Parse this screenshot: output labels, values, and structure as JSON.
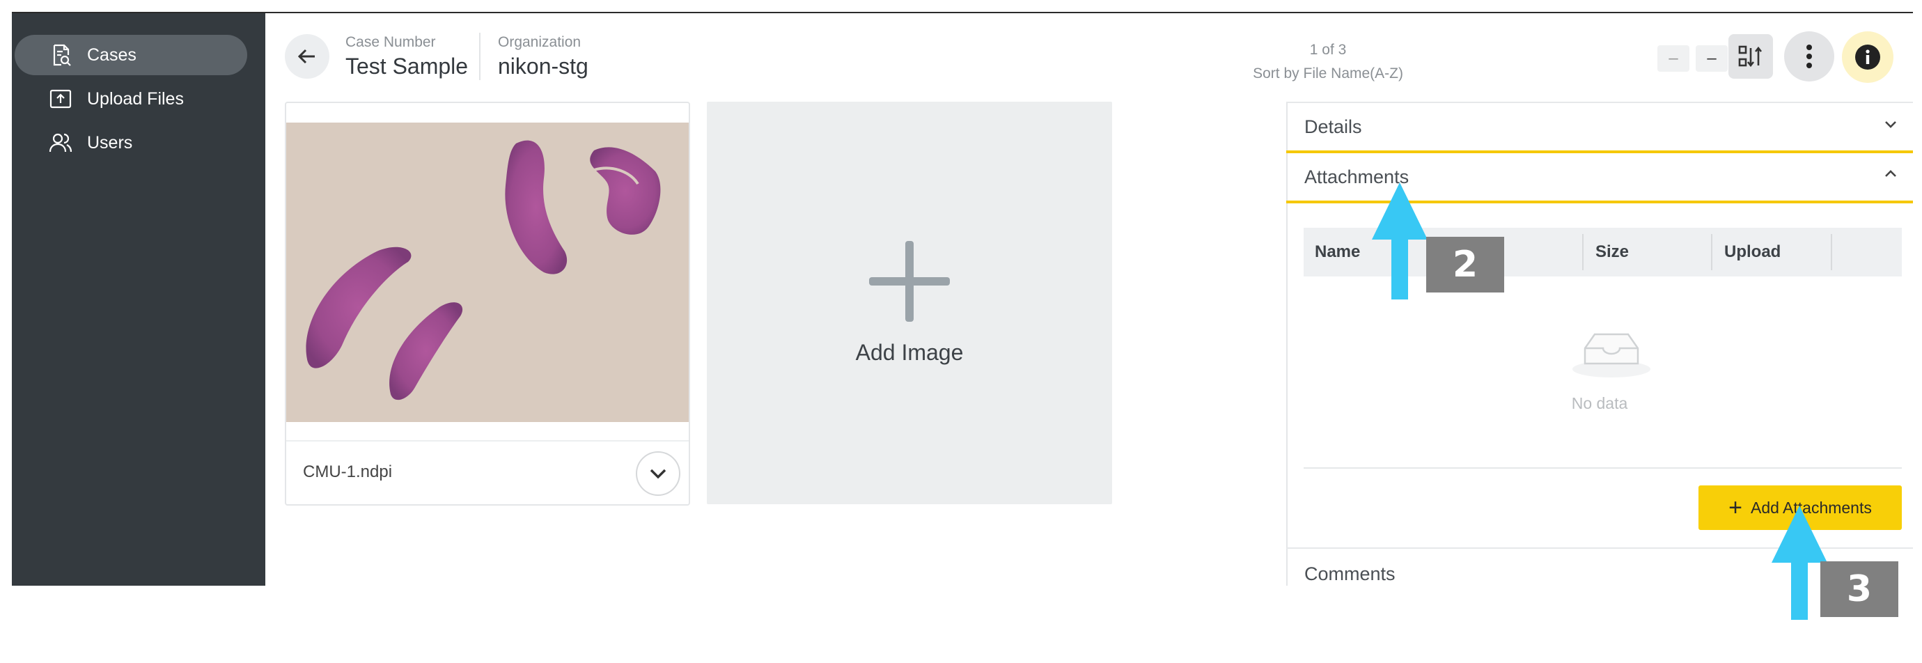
{
  "sidebar": {
    "items": [
      {
        "label": "Cases",
        "icon": "case-search-icon",
        "active": true
      },
      {
        "label": "Upload Files",
        "icon": "upload-icon",
        "active": false
      },
      {
        "label": "Users",
        "icon": "users-icon",
        "active": false
      }
    ]
  },
  "header": {
    "case_number_label": "Case Number",
    "case_number_value": "Test Sample",
    "organization_label": "Organization",
    "organization_value": "nikon-stg",
    "pager_count": "1 of 3",
    "sort_text": "Sort by File Name(A-Z)",
    "prev_label": "–",
    "next_label": "–"
  },
  "images": {
    "items": [
      {
        "file_name": "CMU-1.ndpi"
      }
    ],
    "add_label": "Add Image"
  },
  "panel": {
    "details_label": "Details",
    "attachments_label": "Attachments",
    "columns": [
      "Name",
      "Size",
      "Upload"
    ],
    "empty_text": "No data",
    "add_attachments_label": "Add Attachments",
    "comments_label": "Comments"
  },
  "callouts": [
    "2",
    "3"
  ],
  "colors": {
    "sidebar_bg": "#343a3f",
    "accent_yellow": "#f8cf08",
    "callout_arrow": "#38c8f4",
    "callout_box": "#808080"
  }
}
